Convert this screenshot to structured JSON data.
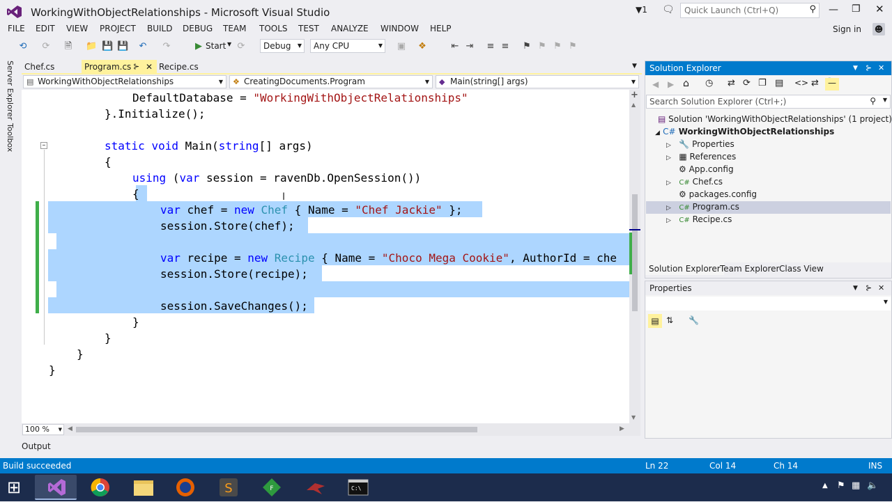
{
  "window": {
    "title": "WorkingWithObjectRelationships - Microsoft Visual Studio",
    "notify_count": "1",
    "quicklaunch_placeholder": "Quick Launch (Ctrl+Q)",
    "sign_in": "Sign in"
  },
  "menu": [
    "FILE",
    "EDIT",
    "VIEW",
    "PROJECT",
    "BUILD",
    "DEBUG",
    "TEAM",
    "TOOLS",
    "TEST",
    "ANALYZE",
    "WINDOW",
    "HELP"
  ],
  "toolbar": {
    "start": "Start",
    "config": "Debug",
    "platform": "Any CPU"
  },
  "left_strip": {
    "server_explorer": "Server Explorer",
    "toolbox": "Toolbox"
  },
  "doc_tabs": [
    "Chef.cs",
    "Program.cs",
    "Recipe.cs"
  ],
  "nav": {
    "project": "WorkingWithObjectRelationships",
    "class": "CreatingDocuments.Program",
    "member": "Main(string[] args)"
  },
  "code": {
    "l1": [
      "DefaultDatabase = ",
      "\"WorkingWithObjectRelationships\""
    ],
    "l2": "}.Initialize();",
    "l3": [
      "static",
      " ",
      "void",
      " Main(",
      "string",
      "[] args)"
    ],
    "l4": "{",
    "l5": [
      "using",
      " (",
      "var",
      " session = ravenDb.OpenSession())"
    ],
    "l6": "{",
    "l7": [
      "var",
      " chef = ",
      "new",
      " ",
      "Chef",
      " { Name = ",
      "\"Chef Jackie\"",
      " };"
    ],
    "l8": "session.Store(chef);",
    "l9": [
      "var",
      " recipe = ",
      "new",
      " ",
      "Recipe",
      " { Name = ",
      "\"Choco Mega Cookie\"",
      ", AuthorId = che"
    ],
    "l10": "session.Store(recipe);",
    "l11": "session.SaveChanges();",
    "l12": "}",
    "l13": "}",
    "l14": "}",
    "l15": "}"
  },
  "zoom": "100 %",
  "solution_explorer": {
    "title": "Solution Explorer",
    "search_placeholder": "Search Solution Explorer (Ctrl+;)",
    "items": [
      "Solution 'WorkingWithObjectRelationships' (1 project)",
      "WorkingWithObjectRelationships",
      "Properties",
      "References",
      "App.config",
      "Chef.cs",
      "packages.config",
      "Program.cs",
      "Recipe.cs"
    ],
    "tabs": [
      "Solution Explorer",
      "Team Explorer",
      "Class View"
    ]
  },
  "properties": {
    "title": "Properties"
  },
  "output": {
    "label": "Output"
  },
  "status": {
    "message": "Build succeeded",
    "ln": "Ln 22",
    "col": "Col 14",
    "ch": "Ch 14",
    "mode": "INS"
  },
  "colors": {
    "accent": "#007acc",
    "vs_purple": "#68217a",
    "selection": "#add6ff"
  }
}
